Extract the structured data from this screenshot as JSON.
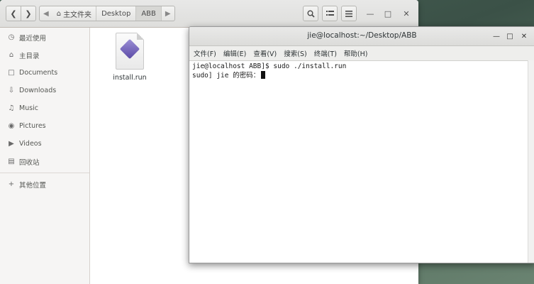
{
  "file_manager": {
    "breadcrumbs": [
      "主文件夹",
      "Desktop",
      "ABB"
    ],
    "sidebar": [
      {
        "label": "最近使用",
        "icon": "clock-icon"
      },
      {
        "label": "主目录",
        "icon": "home-icon"
      },
      {
        "label": "Documents",
        "icon": "document-icon"
      },
      {
        "label": "Downloads",
        "icon": "download-icon"
      },
      {
        "label": "Music",
        "icon": "music-icon"
      },
      {
        "label": "Pictures",
        "icon": "camera-icon"
      },
      {
        "label": "Videos",
        "icon": "video-icon"
      },
      {
        "label": "回收站",
        "icon": "trash-icon"
      },
      {
        "label": "其他位置",
        "icon": "plus-icon"
      }
    ],
    "files": [
      {
        "name": "install.run",
        "icon": "run-file-icon"
      }
    ]
  },
  "terminal": {
    "title": "jie@localhost:~/Desktop/ABB",
    "menu": [
      "文件(F)",
      "编辑(E)",
      "查看(V)",
      "搜索(S)",
      "终端(T)",
      "帮助(H)"
    ],
    "lines": [
      "jie@localhost ABB]$ sudo ./install.run",
      "sudo] jie 的密码："
    ]
  }
}
